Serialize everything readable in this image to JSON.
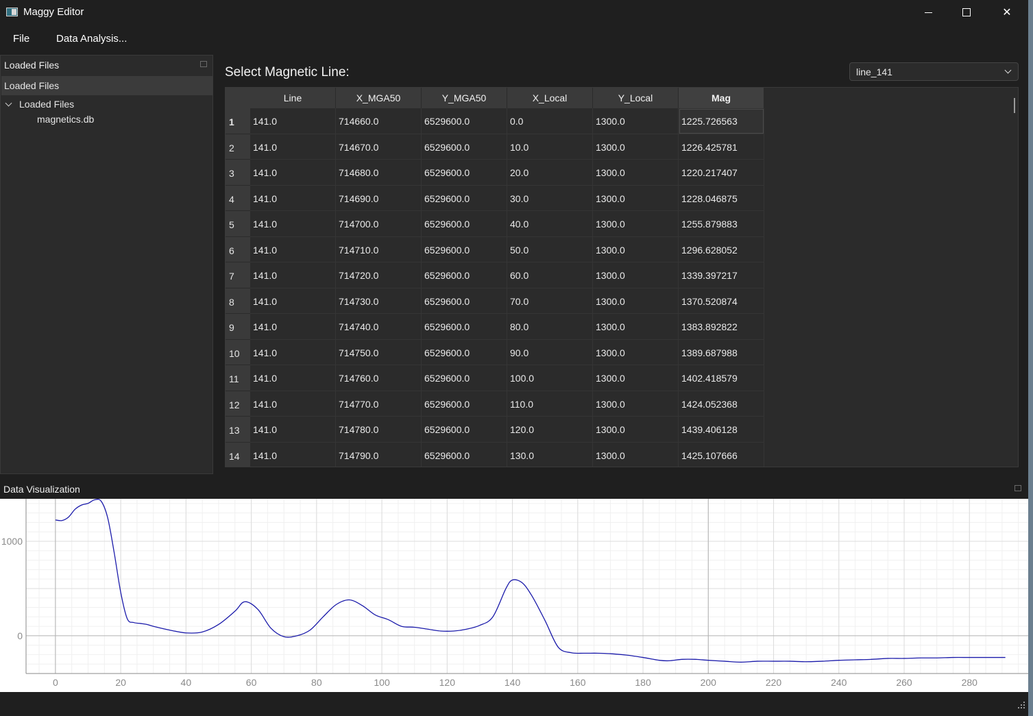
{
  "window": {
    "title": "Maggy Editor"
  },
  "menu": {
    "file": "File",
    "data_analysis": "Data Analysis..."
  },
  "left_dock": {
    "title": "Loaded Files",
    "tree_header": "Loaded Files",
    "root_label": "Loaded Files",
    "child_label": "magnetics.db"
  },
  "main": {
    "select_label": "Select Magnetic Line:",
    "combo_value": "line_141"
  },
  "table": {
    "columns": [
      "Line",
      "X_MGA50",
      "Y_MGA50",
      "X_Local",
      "Y_Local",
      "Mag"
    ],
    "row_numbers": [
      "1",
      "2",
      "3",
      "4",
      "5",
      "6",
      "7",
      "8",
      "9",
      "10",
      "11",
      "12",
      "13",
      "14"
    ],
    "rows": [
      [
        "141.0",
        "714660.0",
        "6529600.0",
        "0.0",
        "1300.0",
        "1225.726563"
      ],
      [
        "141.0",
        "714670.0",
        "6529600.0",
        "10.0",
        "1300.0",
        "1226.425781"
      ],
      [
        "141.0",
        "714680.0",
        "6529600.0",
        "20.0",
        "1300.0",
        "1220.217407"
      ],
      [
        "141.0",
        "714690.0",
        "6529600.0",
        "30.0",
        "1300.0",
        "1228.046875"
      ],
      [
        "141.0",
        "714700.0",
        "6529600.0",
        "40.0",
        "1300.0",
        "1255.879883"
      ],
      [
        "141.0",
        "714710.0",
        "6529600.0",
        "50.0",
        "1300.0",
        "1296.628052"
      ],
      [
        "141.0",
        "714720.0",
        "6529600.0",
        "60.0",
        "1300.0",
        "1339.397217"
      ],
      [
        "141.0",
        "714730.0",
        "6529600.0",
        "70.0",
        "1300.0",
        "1370.520874"
      ],
      [
        "141.0",
        "714740.0",
        "6529600.0",
        "80.0",
        "1300.0",
        "1383.892822"
      ],
      [
        "141.0",
        "714750.0",
        "6529600.0",
        "90.0",
        "1300.0",
        "1389.687988"
      ],
      [
        "141.0",
        "714760.0",
        "6529600.0",
        "100.0",
        "1300.0",
        "1402.418579"
      ],
      [
        "141.0",
        "714770.0",
        "6529600.0",
        "110.0",
        "1300.0",
        "1424.052368"
      ],
      [
        "141.0",
        "714780.0",
        "6529600.0",
        "120.0",
        "1300.0",
        "1439.406128"
      ],
      [
        "141.0",
        "714790.0",
        "6529600.0",
        "130.0",
        "1300.0",
        "1425.107666"
      ]
    ]
  },
  "bottom_dock": {
    "title": "Data Visualization"
  },
  "colors": {
    "line": "#1a1aaa",
    "background": "#1f1f1f",
    "panel": "#2b2b2b"
  },
  "chart_data": {
    "type": "line",
    "xlim": [
      -9,
      298
    ],
    "ylim": [
      -400,
      1450
    ],
    "xticks": [
      0,
      20,
      40,
      60,
      80,
      100,
      120,
      140,
      160,
      180,
      200,
      220,
      240,
      260,
      280
    ],
    "yticks": [
      0,
      1000
    ],
    "grid": true,
    "x": [
      0,
      2,
      4,
      6,
      8,
      10,
      12,
      14,
      16,
      18,
      20,
      22,
      24,
      26,
      28,
      30,
      35,
      40,
      45,
      50,
      55,
      58,
      62,
      66,
      70,
      74,
      78,
      82,
      86,
      90,
      94,
      98,
      102,
      106,
      110,
      114,
      118,
      122,
      126,
      130,
      134,
      138,
      140,
      143,
      146,
      150,
      154,
      158,
      162,
      166,
      170,
      175,
      180,
      185,
      188,
      192,
      196,
      200,
      205,
      210,
      215,
      220,
      225,
      230,
      235,
      240,
      245,
      250,
      255,
      260,
      265,
      270,
      275,
      280,
      285,
      291
    ],
    "y": [
      1226,
      1220,
      1256,
      1339,
      1384,
      1402,
      1439,
      1425,
      1250,
      880,
      460,
      180,
      140,
      130,
      120,
      100,
      60,
      30,
      40,
      120,
      260,
      360,
      280,
      80,
      -10,
      0,
      60,
      200,
      330,
      380,
      320,
      220,
      170,
      100,
      90,
      70,
      50,
      50,
      70,
      110,
      200,
      500,
      590,
      560,
      420,
      160,
      -120,
      -180,
      -185,
      -185,
      -190,
      -205,
      -230,
      -260,
      -265,
      -250,
      -250,
      -260,
      -270,
      -280,
      -270,
      -270,
      -270,
      -275,
      -270,
      -260,
      -255,
      -250,
      -240,
      -240,
      -235,
      -235,
      -230,
      -230,
      -230,
      -230
    ]
  }
}
